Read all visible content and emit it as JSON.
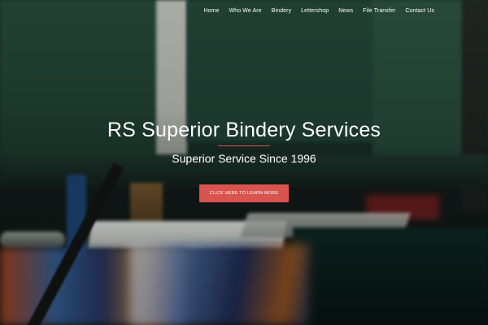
{
  "nav": {
    "items": [
      {
        "label": "Home"
      },
      {
        "label": "Who We Are"
      },
      {
        "label": "Bindery"
      },
      {
        "label": "Lettershop"
      },
      {
        "label": "News"
      },
      {
        "label": "File Transfer"
      },
      {
        "label": "Contact Us"
      }
    ]
  },
  "hero": {
    "title": "RS Superior Bindery Services",
    "subtitle": "Superior Service Since 1996",
    "cta_label": "CLICK HERE TO LEARN MORE"
  },
  "colors": {
    "accent": "#d9534f",
    "text": "#ffffff"
  }
}
